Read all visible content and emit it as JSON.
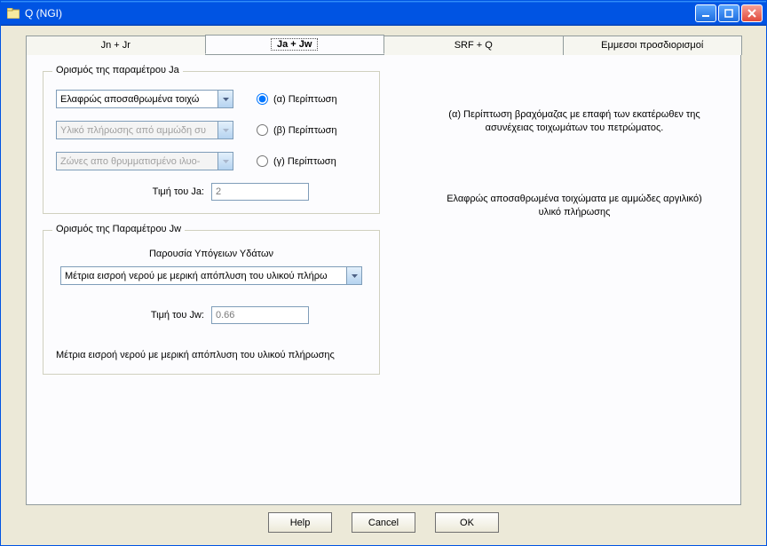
{
  "window": {
    "title": "Q (NGI)"
  },
  "tabs": [
    {
      "label": "Jn + Jr"
    },
    {
      "label": "Ja + Jw"
    },
    {
      "label": "SRF + Q"
    },
    {
      "label": "Εμμεσοι προσδιορισμοί"
    }
  ],
  "ja_group": {
    "title": "Ορισμός της παραμέτρου Ja",
    "combo1": "Ελαφρώς αποσαθρωμένα τοιχώ",
    "combo2": "Υλικό πλήρωσης από αμμώδη συ",
    "combo3": "Ζώνες απο θρυμματισμένο ιλυο-",
    "radio_a": "(α) Περίπτωση",
    "radio_b": "(β) Περίπτωση",
    "radio_c": "(γ) Περίπτωση",
    "value_label": "Τιμή του Ja:",
    "value": "2"
  },
  "ja_side": {
    "line1": "(α) Περίπτωση βραχόμαζας με επαφή των εκατέρωθεν της ασυνέχειας τοιχωμάτων του πετρώματος.",
    "line2": "Ελαφρώς αποσαθρωμένα τοιχώματα με αμμώδες αργιλικό) υλικό πλήρωσης"
  },
  "jw_group": {
    "title": "Ορισμός της Παραμέτρου Jw",
    "header": "Παρουσία Υπόγειων Υδάτων",
    "combo": "Μέτρια εισροή νερού με μερική απόπλυση του υλικού πλήρω",
    "value_label": "Τιμή του Jw:",
    "value": "0.66",
    "desc": "Μέτρια εισροή νερού με μερική απόπλυση του υλικού πλήρωσης"
  },
  "buttons": {
    "help": "Help",
    "cancel": "Cancel",
    "ok": "OK"
  }
}
